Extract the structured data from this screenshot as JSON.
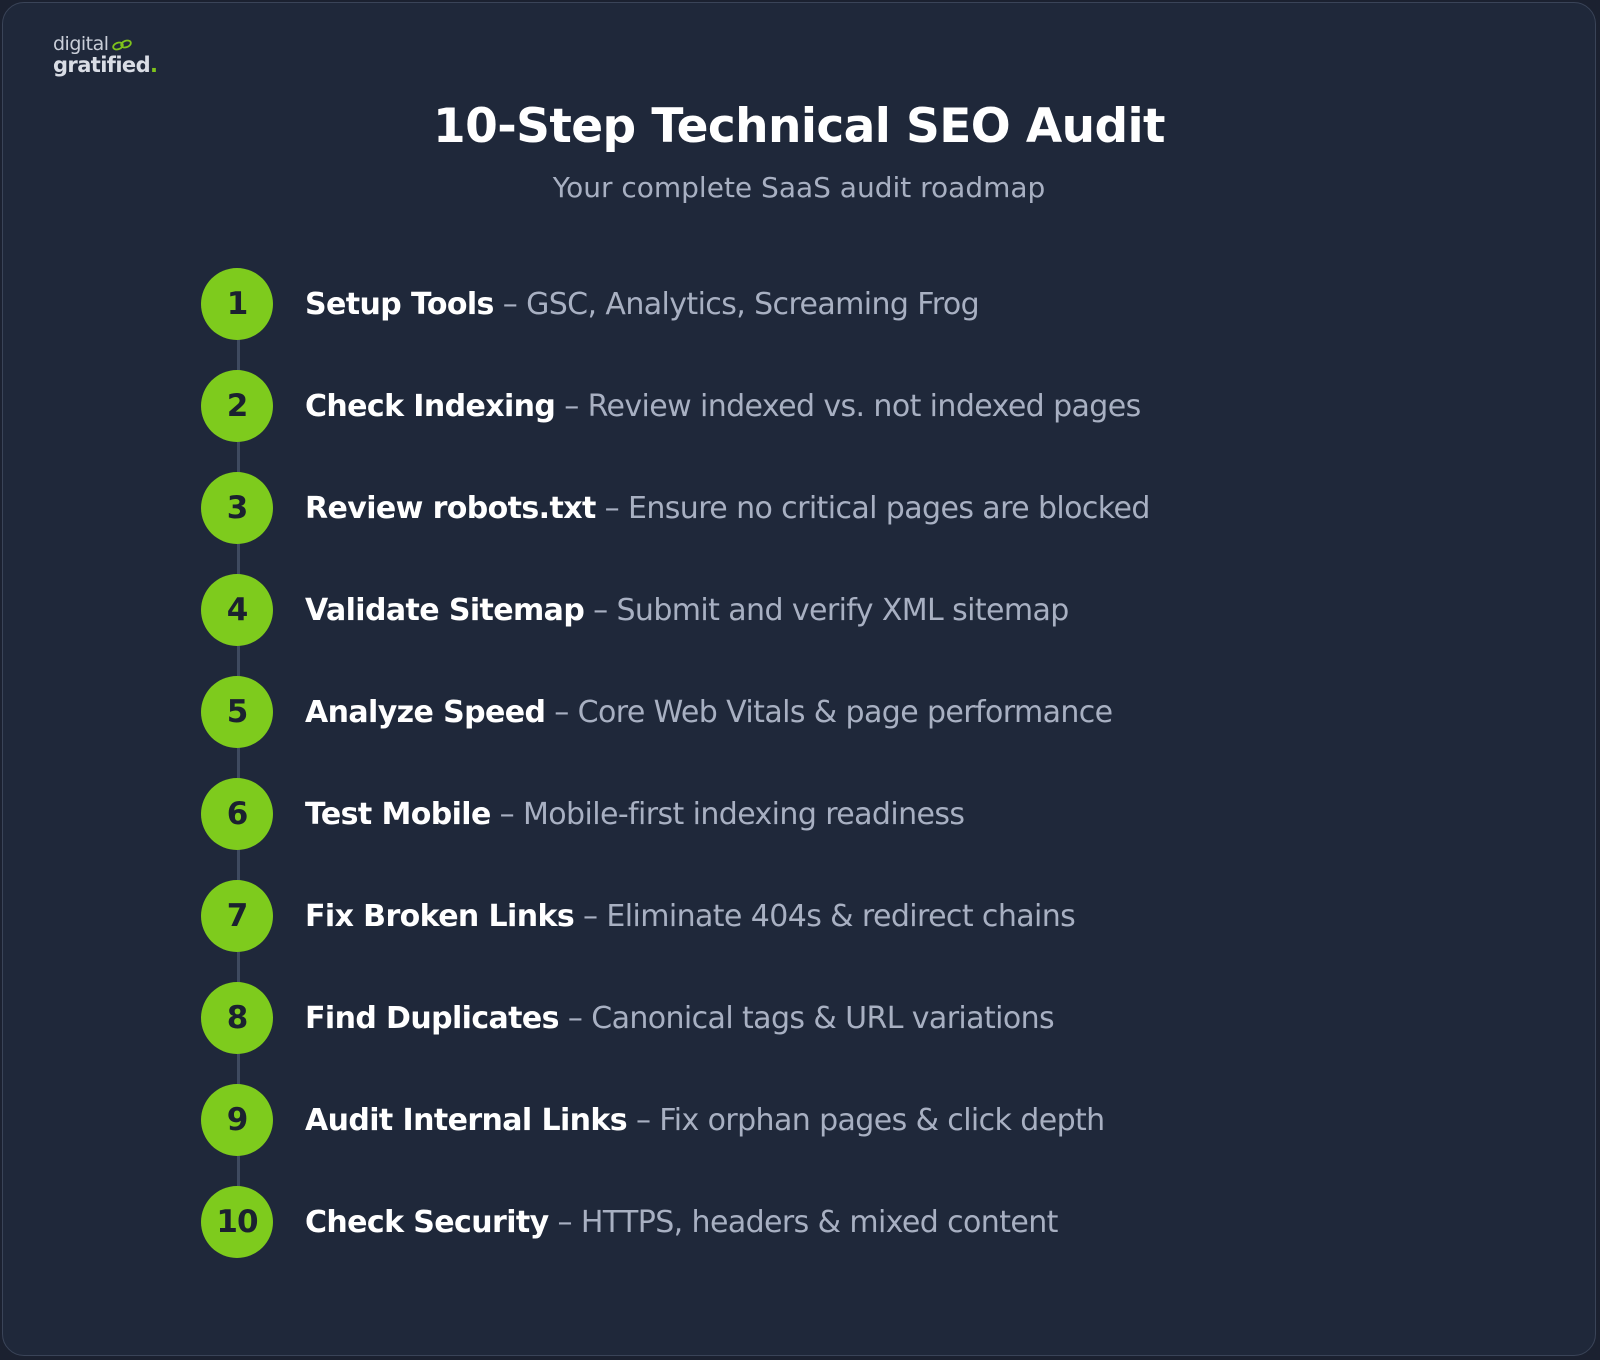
{
  "logo": {
    "line1": "digital",
    "line2": "gratified",
    "dot": "."
  },
  "title": "10-Step Technical SEO Audit",
  "subtitle": "Your complete SaaS audit roadmap",
  "separator": " – ",
  "colors": {
    "accent": "#7ecb1d",
    "background": "#1f283a",
    "title": "#ffffff",
    "muted": "#a8b0c2"
  },
  "steps": [
    {
      "number": "1",
      "label": "Setup Tools",
      "description": "GSC, Analytics, Screaming Frog"
    },
    {
      "number": "2",
      "label": "Check Indexing",
      "description": "Review indexed vs. not indexed pages"
    },
    {
      "number": "3",
      "label": "Review robots.txt",
      "description": "Ensure no critical pages are blocked"
    },
    {
      "number": "4",
      "label": "Validate Sitemap",
      "description": "Submit and verify XML sitemap"
    },
    {
      "number": "5",
      "label": "Analyze Speed",
      "description": "Core Web Vitals & page performance"
    },
    {
      "number": "6",
      "label": "Test Mobile",
      "description": "Mobile-first indexing readiness"
    },
    {
      "number": "7",
      "label": "Fix Broken Links",
      "description": "Eliminate 404s & redirect chains"
    },
    {
      "number": "8",
      "label": "Find Duplicates",
      "description": "Canonical tags & URL variations"
    },
    {
      "number": "9",
      "label": "Audit Internal Links",
      "description": "Fix orphan pages & click depth"
    },
    {
      "number": "10",
      "label": "Check Security",
      "description": "HTTPS, headers & mixed content"
    }
  ]
}
